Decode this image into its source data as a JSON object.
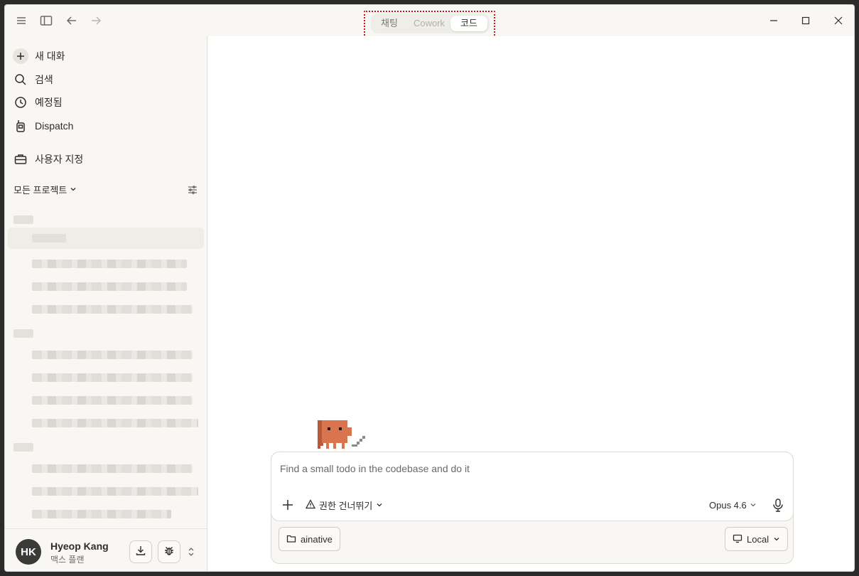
{
  "titlebar": {
    "mode_tabs": [
      {
        "label": "채팅",
        "active": false
      },
      {
        "label": "Cowork",
        "active": false
      },
      {
        "label": "코드",
        "active": true
      }
    ]
  },
  "sidebar": {
    "nav": [
      {
        "label": "새 대화",
        "icon": "plus-icon"
      },
      {
        "label": "검색",
        "icon": "search-icon"
      },
      {
        "label": "예정됨",
        "icon": "clock-icon"
      },
      {
        "label": "Dispatch",
        "icon": "walkie-talkie-icon"
      },
      {
        "label": "사용자 지정",
        "icon": "toolbox-icon"
      }
    ],
    "projects_label": "모든 프로젝트"
  },
  "user": {
    "initials": "HK",
    "name": "Hyeop Kang",
    "plan": "맥스 플랜"
  },
  "composer": {
    "prompt": "Find a small todo in the codebase and do it",
    "permission_label": "권한 건너뛰기",
    "model_label": "Opus 4.6",
    "folder_label": "ainative",
    "env_label": "Local"
  },
  "colors": {
    "accent_highlight": "#d4111b",
    "mascot": "#d9744f"
  }
}
